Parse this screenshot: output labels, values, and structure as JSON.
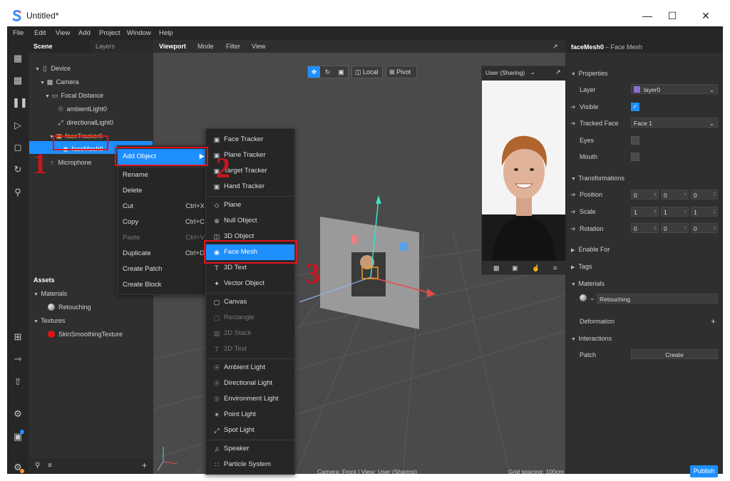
{
  "window": {
    "title": "Untitled*"
  },
  "menu": [
    "File",
    "Edit",
    "View",
    "Add",
    "Project",
    "Window",
    "Help"
  ],
  "scene_tabs": {
    "scene": "Scene",
    "layers": "Layers"
  },
  "scene_tree": {
    "device": "Device",
    "camera": "Camera",
    "focal": "Focal Distance",
    "ambient": "ambientLight0",
    "directional": "directionalLight0",
    "facetracker": "faceTracker0",
    "facemesh": "faceMesh0",
    "microphone": "Microphone"
  },
  "assets": {
    "title": "Assets",
    "materials": "Materials",
    "retouching": "Retouching",
    "textures": "Textures",
    "skin": "SkinSmoothingTexture"
  },
  "viewport": {
    "tabs": [
      "Viewport",
      "Mode",
      "Filter",
      "View"
    ],
    "local": "Local",
    "pivot": "Pivot",
    "preview_device": "User (Sharing)",
    "status_camera": "Camera: Front | View: User (Sharing)",
    "status_grid": "Grid spacing: 100cm"
  },
  "context_menu": {
    "add_object": "Add Object",
    "rename": "Rename",
    "delete": "Delete",
    "cut": "Cut",
    "cut_sc": "Ctrl+X",
    "copy": "Copy",
    "copy_sc": "Ctrl+C",
    "paste": "Paste",
    "paste_sc": "Ctrl+V",
    "duplicate": "Duplicate",
    "duplicate_sc": "Ctrl+D",
    "create_patch": "Create Patch",
    "create_block": "Create Block"
  },
  "submenu": {
    "face_tracker": "Face Tracker",
    "plane_tracker": "Plane Tracker",
    "target_tracker": "Target Tracker",
    "hand_tracker": "Hand Tracker",
    "plane": "Plane",
    "null_object": "Null Object",
    "object_3d": "3D Object",
    "face_mesh": "Face Mesh",
    "text_3d": "3D Text",
    "vector_object": "Vector Object",
    "canvas": "Canvas",
    "rectangle": "Rectangle",
    "stack_2d": "2D Stack",
    "text_2d": "2D Text",
    "ambient_light": "Ambient Light",
    "directional_light": "Directional Light",
    "environment_light": "Environment Light",
    "point_light": "Point Light",
    "spot_light": "Spot Light",
    "speaker": "Speaker",
    "particle_system": "Particle System"
  },
  "annotations": {
    "n1": "1",
    "n2": "2",
    "n3": "3"
  },
  "inspector": {
    "object": "faceMesh0",
    "type": "– Face Mesh",
    "properties": "Properties",
    "layer": "Layer",
    "layer_value": "layer0",
    "visible": "Visible",
    "tracked_face": "Tracked Face",
    "tracked_face_value": "Face 1",
    "eyes": "Eyes",
    "mouth": "Mouth",
    "transformations": "Transformations",
    "position": "Position",
    "scale": "Scale",
    "rotation": "Rotation",
    "pos": [
      "0",
      "0",
      "0"
    ],
    "scl": [
      "1",
      "1",
      "1"
    ],
    "rot": [
      "0",
      "0",
      "0"
    ],
    "axes": [
      "X",
      "Y",
      "Z"
    ],
    "enable_for": "Enable For",
    "tags": "Tags",
    "materials": "Materials",
    "material_value": "Retouching",
    "deformation": "Deformation",
    "interactions": "Interactions",
    "patch": "Patch",
    "create": "Create",
    "publish": "Publish"
  },
  "colors": {
    "accent": "#1e8fff",
    "annotation": "#c8161d",
    "layer_swatch": "#8a6fd1",
    "texture_swatch": "#e01414"
  }
}
